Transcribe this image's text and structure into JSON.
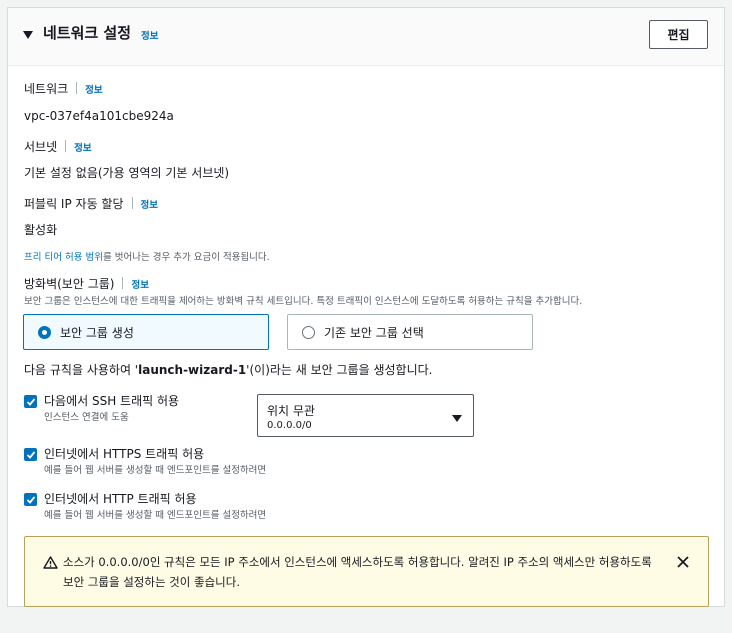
{
  "header": {
    "title": "네트워크 설정",
    "info": "정보",
    "edit_label": "편집"
  },
  "fields": {
    "network": {
      "label": "네트워크",
      "info": "정보",
      "value": "vpc-037ef4a101cbe924a"
    },
    "subnet": {
      "label": "서브넷",
      "info": "정보",
      "value": "기본 설정 없음(가용 영역의 기본 서브넷)"
    },
    "public_ip": {
      "label": "퍼블릭 IP 자동 할당",
      "info": "정보",
      "value": "활성화"
    },
    "free_tier": {
      "link": "프리 티어 허용 범위",
      "rest": "를 벗어나는 경우 추가 요금이 적용됩니다."
    },
    "firewall": {
      "label": "방화벽(보안 그룹)",
      "info": "정보",
      "description": "보안 그룹은 인스턴스에 대한 트래픽을 제어하는 방화벽 규칙 세트입니다. 특정 트래픽이 인스턴스에 도달하도록 허용하는 규칙을 추가합니다.",
      "option_create": "보안 그룹 생성",
      "option_existing": "기존 보안 그룹 선택"
    }
  },
  "rule_sentence": {
    "prefix": "다음 규칙을 사용하여 '",
    "name": "launch-wizard-1",
    "suffix": "'(이)라는 새 보안 그룹을 생성합니다."
  },
  "rules": [
    {
      "label": "다음에서 SSH 트래픽 허용",
      "description": "인스턴스 연결에 도움",
      "checked": true
    },
    {
      "label": "인터넷에서 HTTPS 트래픽 허용",
      "description": "예를 들어 웹 서버를 생성할 때 엔드포인트를 설정하려면",
      "checked": true
    },
    {
      "label": "인터넷에서 HTTP 트래픽 허용",
      "description": "예를 들어 웹 서버를 생성할 때 엔드포인트를 설정하려면",
      "checked": true
    }
  ],
  "ssh_source": {
    "selected": "위치 무관",
    "value": "0.0.0.0/0"
  },
  "alert": {
    "text": "소스가 0.0.0.0/0인 규칙은 모든 IP 주소에서 인스턴스에 액세스하도록 허용합니다. 알려진 IP 주소의 액세스만 허용하도록 보안 그룹을 설정하는 것이 좋습니다."
  },
  "colors": {
    "link": "#0073bb",
    "accent": "#0073bb",
    "warning_bg": "#fffce6",
    "warning_border": "#b9a05a"
  },
  "icons": {
    "caret": "caret-down-icon",
    "warning": "warning-icon",
    "close": "close-icon",
    "check": "check-icon",
    "select_caret": "caret-down-icon"
  }
}
